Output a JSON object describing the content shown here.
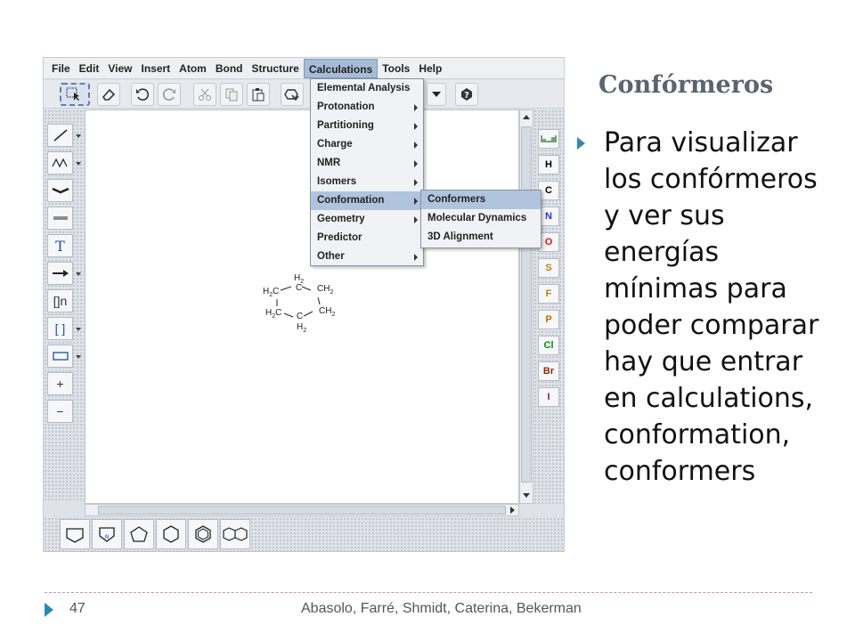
{
  "slide": {
    "title": "Confórmeros",
    "bullet": "Para visualizar los confórmeros y ver sus energías mínimas para poder comparar hay que entrar en calculations, conformation, conformers",
    "page_number": "47",
    "authors": "Abasolo, Farré, Shmidt, Caterina, Bekerman",
    "accent_color": "#2d8ab3"
  },
  "app": {
    "menubar": [
      "File",
      "Edit",
      "View",
      "Insert",
      "Atom",
      "Bond",
      "Structure",
      "Calculations",
      "Tools",
      "Help"
    ],
    "active_menu": "Calculations",
    "calculations_menu": [
      {
        "label": "Elemental Analysis",
        "submenu": false
      },
      {
        "label": "Protonation",
        "submenu": true
      },
      {
        "label": "Partitioning",
        "submenu": true
      },
      {
        "label": "Charge",
        "submenu": true
      },
      {
        "label": "NMR",
        "submenu": true
      },
      {
        "label": "Isomers",
        "submenu": true
      },
      {
        "label": "Conformation",
        "submenu": true,
        "highlighted": true
      },
      {
        "label": "Geometry",
        "submenu": true
      },
      {
        "label": "Predictor",
        "submenu": false
      },
      {
        "label": "Other",
        "submenu": true
      }
    ],
    "conformation_submenu": [
      {
        "label": "Conformers",
        "highlighted": true
      },
      {
        "label": "Molecular Dynamics"
      },
      {
        "label": "3D Alignment"
      }
    ],
    "toolbar_icons": [
      "select-icon",
      "eraser-icon",
      "undo-icon",
      "redo-icon",
      "cut-icon",
      "copy-icon",
      "paste-icon",
      "clean-icon",
      "help-icon"
    ],
    "left_tools": [
      "single-bond-icon",
      "chain-icon",
      "bold-bond-icon",
      "hashed-bond-icon",
      "text-icon",
      "arrow-icon",
      "sgroup-bracket-icon",
      "bracket-icon",
      "rectangle-icon",
      "plus-icon",
      "minus-icon"
    ],
    "left_labels": {
      "text": "T",
      "bracket_n": "[]n",
      "bracket": "[ ]",
      "plus": "+",
      "minus": "−"
    },
    "atoms": [
      {
        "symbol": "H",
        "color": "#222222"
      },
      {
        "symbol": "C",
        "color": "#222222"
      },
      {
        "symbol": "N",
        "color": "#2233cc"
      },
      {
        "symbol": "O",
        "color": "#dd1111"
      },
      {
        "symbol": "S",
        "color": "#b08a00"
      },
      {
        "symbol": "F",
        "color": "#b08a00"
      },
      {
        "symbol": "P",
        "color": "#cc6600"
      },
      {
        "symbol": "Cl",
        "color": "#118811"
      },
      {
        "symbol": "Br",
        "color": "#8a2a00"
      },
      {
        "symbol": "I",
        "color": "#7a1a9a"
      }
    ],
    "bottom_templates": [
      "cyclohexane-chair-icon",
      "pyrrole-icon",
      "cyclopentane-icon",
      "cyclohexane-icon",
      "benzene-icon",
      "naphthalene-icon"
    ],
    "molecule": {
      "top": "C",
      "top_h": "H",
      "top_h_sub": "2",
      "bottom": "C",
      "bottom_h": "H",
      "bottom_h_sub": "2",
      "left_top": "H",
      "left_top_sub": "2",
      "left_top_c": "C",
      "left_bottom": "H",
      "left_bottom_sub": "2",
      "left_bottom_c": "C",
      "right_top": "CH",
      "right_top_sub": "2",
      "right_bottom": "CH",
      "right_bottom_sub": "2"
    }
  }
}
